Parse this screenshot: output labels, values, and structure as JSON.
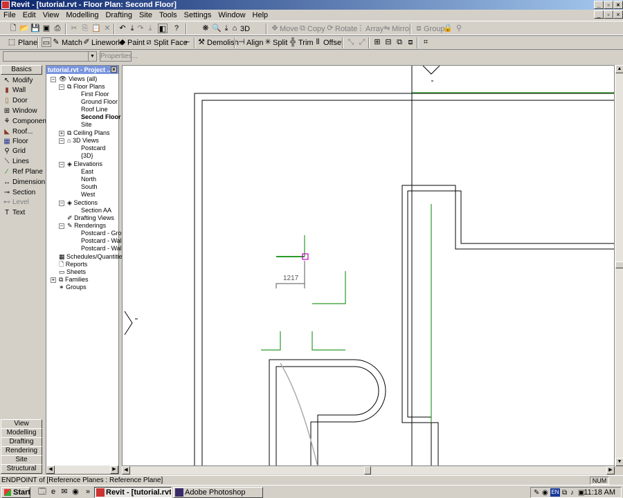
{
  "window": {
    "title": "Revit - [tutorial.rvt - Floor Plan: Second Floor]"
  },
  "menu": [
    "File",
    "Edit",
    "View",
    "Modelling",
    "Drafting",
    "Site",
    "Tools",
    "Settings",
    "Window",
    "Help"
  ],
  "toolbar1": {
    "view3d": "3D",
    "move": "Move",
    "copy": "Copy",
    "rotate": "Rotate",
    "array": "Array",
    "mirror": "Mirror",
    "group": "Group"
  },
  "toolbar2": {
    "plane": "Plane",
    "match": "Match",
    "linework": "Linework",
    "paint": "Paint",
    "splitface": "Split Face",
    "demolish": "Demolish",
    "align": "Align",
    "split": "Split",
    "trim": "Trim",
    "offset": "Offset"
  },
  "properties": {
    "label": "Properties..."
  },
  "design_bar": {
    "active_tab": "Basics",
    "items": [
      "Modify",
      "Wall",
      "Door",
      "Window",
      "Component",
      "Roof...",
      "Floor",
      "Grid",
      "Lines",
      "Ref Plane",
      "Dimension",
      "Section",
      "Level",
      "Text"
    ],
    "tabs": [
      "View",
      "Modelling",
      "Drafting",
      "Rendering",
      "Site",
      "Structural"
    ]
  },
  "project_browser": {
    "title": "tutorial.rvt - Project ...",
    "nodes": [
      "Views (all)",
      "Floor Plans",
      "First Floor",
      "Ground Floor",
      "Roof Line",
      "Second Floor",
      "Site",
      "Ceiling Plans",
      "3D Views",
      "Postcard",
      "{3D}",
      "Elevations",
      "East",
      "North",
      "South",
      "West",
      "Sections",
      "Section AA",
      "Drafting Views",
      "Renderings",
      "Postcard - Grou",
      "Postcard - Wall-",
      "Postcard - Wall-",
      "Schedules/Quantitie",
      "Reports",
      "Sheets",
      "Families",
      "Groups"
    ]
  },
  "drawing": {
    "dimension_value": "1217"
  },
  "status": {
    "text": "ENDPOINT  of [Reference Planes : Reference Plane]",
    "num": "NUM"
  },
  "taskbar": {
    "start": "Start",
    "tasks": [
      "Revit - [tutorial.rvt ...",
      "Adobe Photoshop"
    ],
    "tray_lang": "EN",
    "clock": "11:18 AM"
  }
}
